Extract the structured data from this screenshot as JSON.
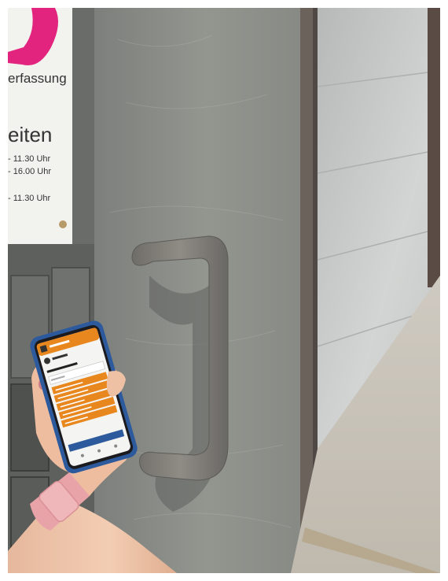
{
  "photo": {
    "sign": {
      "line1": "erfassung",
      "line2": "eiten",
      "line3": "- 11.30 Uhr",
      "line4": "- 16.00 Uhr",
      "line5": "- 11.30 Uhr"
    },
    "colors": {
      "door_metal": "#8f918e",
      "wall_panel": "#c9cbc9",
      "handle": "#7f7d78",
      "app_orange": "#e8871e",
      "logo_pink": "#e2247f",
      "phone_case": "#2d5a9c",
      "watch_band": "#e8a3a8"
    }
  }
}
